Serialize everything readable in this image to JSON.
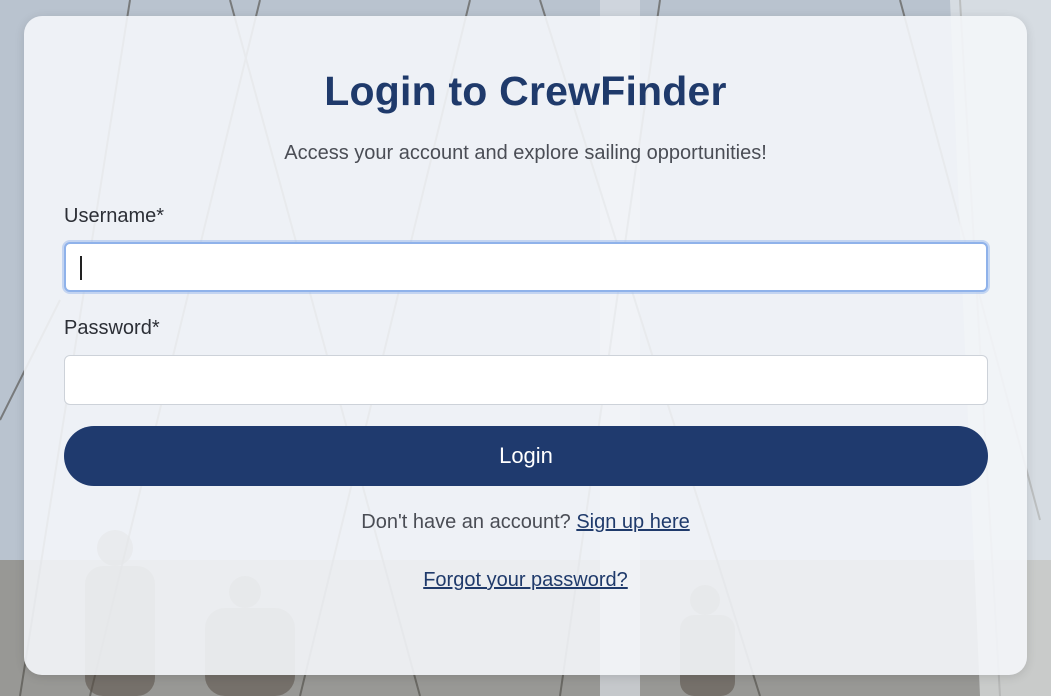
{
  "login": {
    "title": "Login to CrewFinder",
    "subtitle": "Access your account and explore sailing opportunities!",
    "username_label": "Username*",
    "username_value": "",
    "password_label": "Password*",
    "password_value": "",
    "submit_label": "Login",
    "signup_prompt": "Don't have an account?",
    "signup_link": "Sign up here",
    "forgot_link": "Forgot your password?"
  },
  "colors": {
    "brand": "#1f3a6e",
    "title": "#1f3a6b",
    "focus_ring": "#8fb2ea"
  }
}
